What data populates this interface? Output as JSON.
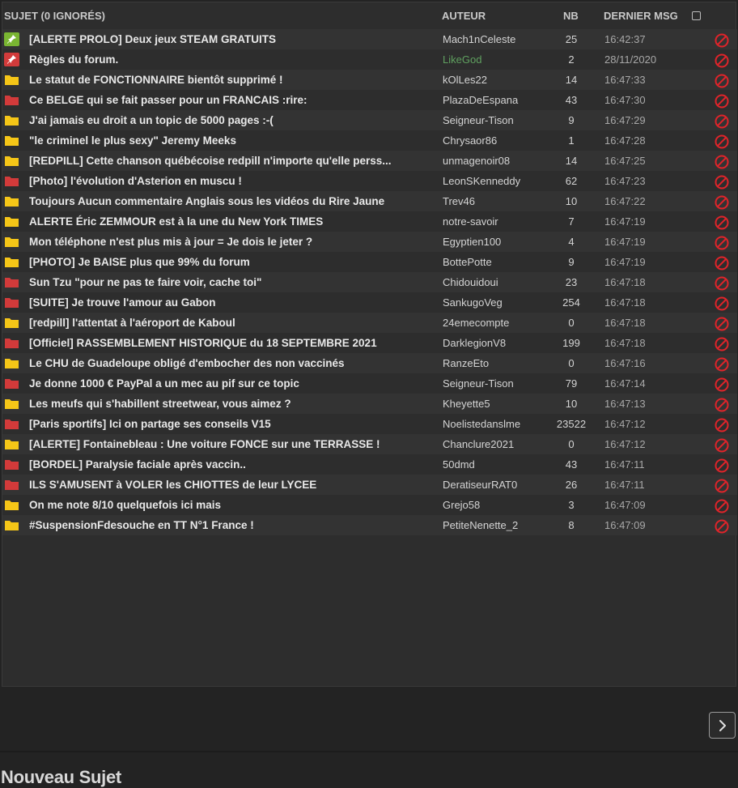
{
  "header": {
    "subject": "SUJET (0 IGNORÉS)",
    "author": "AUTEUR",
    "count": "NB",
    "last_message": "DERNIER MSG"
  },
  "topics": [
    {
      "icon": "pin-green-icon",
      "subject": "[ALERTE PROLO] Deux jeux STEAM GRATUITS",
      "author": "Mach1nCeleste",
      "count": "25",
      "last": "16:42:37"
    },
    {
      "icon": "pin-red-icon",
      "subject": "Règles du forum.",
      "author": "LikeGod",
      "author_color": "#5fa05f",
      "count": "2",
      "last": "28/11/2020"
    },
    {
      "icon": "folder-yellow-icon",
      "subject": "Le statut de FONCTIONNAIRE bientôt supprimé !",
      "author": "kOlLes22",
      "count": "14",
      "last": "16:47:33"
    },
    {
      "icon": "folder-red-icon",
      "subject": "Ce BELGE qui se fait passer pour un FRANCAIS :rire:",
      "author": "PlazaDeEspana",
      "count": "43",
      "last": "16:47:30"
    },
    {
      "icon": "folder-yellow-icon",
      "subject": "J'ai jamais eu droit a un topic de 5000 pages :-(",
      "author": "Seigneur-Tison",
      "count": "9",
      "last": "16:47:29"
    },
    {
      "icon": "folder-yellow-icon",
      "subject": "\"le criminel le plus sexy\" Jeremy Meeks",
      "author": "Chrysaor86",
      "count": "1",
      "last": "16:47:28"
    },
    {
      "icon": "folder-yellow-icon",
      "subject": "[REDPILL] Cette chanson québécoise redpill n'importe qu'elle perss...",
      "author": "unmagenoir08",
      "count": "14",
      "last": "16:47:25"
    },
    {
      "icon": "folder-red-icon",
      "subject": "[Photo] l'évolution d'Asterion en muscu !",
      "author": "LeonSKenneddy",
      "count": "62",
      "last": "16:47:23"
    },
    {
      "icon": "folder-yellow-icon",
      "subject": "Toujours Aucun commentaire Anglais sous les vidéos du Rire Jaune",
      "author": "Trev46",
      "count": "10",
      "last": "16:47:22"
    },
    {
      "icon": "folder-yellow-icon",
      "subject": "ALERTE Éric ZEMMOUR est à la une du New York TIMES",
      "author": "notre-savoir",
      "count": "7",
      "last": "16:47:19"
    },
    {
      "icon": "folder-yellow-icon",
      "subject": "Mon téléphone n'est plus mis à jour = Je dois le jeter ?",
      "author": "Egyptien100",
      "count": "4",
      "last": "16:47:19"
    },
    {
      "icon": "folder-yellow-icon",
      "subject": "[PHOTO] Je BAISE plus que 99% du forum",
      "author": "BottePotte",
      "count": "9",
      "last": "16:47:19"
    },
    {
      "icon": "folder-red-icon",
      "subject": "Sun Tzu \"pour ne pas te faire voir, cache toi\"",
      "author": "Chidouidoui",
      "count": "23",
      "last": "16:47:18"
    },
    {
      "icon": "folder-red-icon",
      "subject": "[SUITE] Je trouve l'amour au Gabon",
      "author": "SankugoVeg",
      "count": "254",
      "last": "16:47:18"
    },
    {
      "icon": "folder-yellow-icon",
      "subject": "[redpill] l'attentat à l'aéroport de Kaboul",
      "author": "24emecompte",
      "count": "0",
      "last": "16:47:18"
    },
    {
      "icon": "folder-red-icon",
      "subject": "[Officiel] RASSEMBLEMENT HISTORIQUE du 18 SEPTEMBRE 2021",
      "author": "DarklegionV8",
      "count": "199",
      "last": "16:47:18"
    },
    {
      "icon": "folder-yellow-icon",
      "subject": "Le CHU de Guadeloupe obligé d'embocher des non vaccinés",
      "author": "RanzeEto",
      "count": "0",
      "last": "16:47:16"
    },
    {
      "icon": "folder-red-icon",
      "subject": "Je donne 1000 € PayPal a un mec au pif sur ce topic",
      "author": "Seigneur-Tison",
      "count": "79",
      "last": "16:47:14"
    },
    {
      "icon": "folder-yellow-icon",
      "subject": "Les meufs qui s'habillent streetwear, vous aimez ?",
      "author": "Kheyette5",
      "count": "10",
      "last": "16:47:13"
    },
    {
      "icon": "folder-red-icon",
      "subject": "[Paris sportifs] Ici on partage ses conseils V15",
      "author": "Noelistedanslme",
      "count": "23522",
      "last": "16:47:12"
    },
    {
      "icon": "folder-yellow-icon",
      "subject": "[ALERTE] Fontainebleau : Une voiture FONCE sur une TERRASSE !",
      "author": "Chanclure2021",
      "count": "0",
      "last": "16:47:12"
    },
    {
      "icon": "folder-red-icon",
      "subject": "[BORDEL] Paralysie faciale après vaccin..",
      "author": "50dmd",
      "count": "43",
      "last": "16:47:11"
    },
    {
      "icon": "folder-red-icon",
      "subject": "ILS S'AMUSENT à VOLER les CHIOTTES de leur LYCEE",
      "author": "DeratiseurRAT0",
      "count": "26",
      "last": "16:47:11"
    },
    {
      "icon": "folder-yellow-icon",
      "subject": "On me note 8/10 quelquefois ici mais",
      "author": "Grejo58",
      "count": "3",
      "last": "16:47:09"
    },
    {
      "icon": "folder-yellow-icon",
      "subject": "#SuspensionFdesouche en TT N°1 France !",
      "author": "PetiteNenette_2",
      "count": "8",
      "last": "16:47:09"
    }
  ],
  "pagination": {
    "next_icon": "chevron-right-icon"
  },
  "new_topic": {
    "title": "Nouveau Sujet"
  },
  "colors": {
    "folder_yellow": "#f5c518",
    "folder_red": "#d23b3b",
    "pin_green": "#7ab532",
    "pin_red": "#d23b3b",
    "ban": "#e0242a"
  }
}
